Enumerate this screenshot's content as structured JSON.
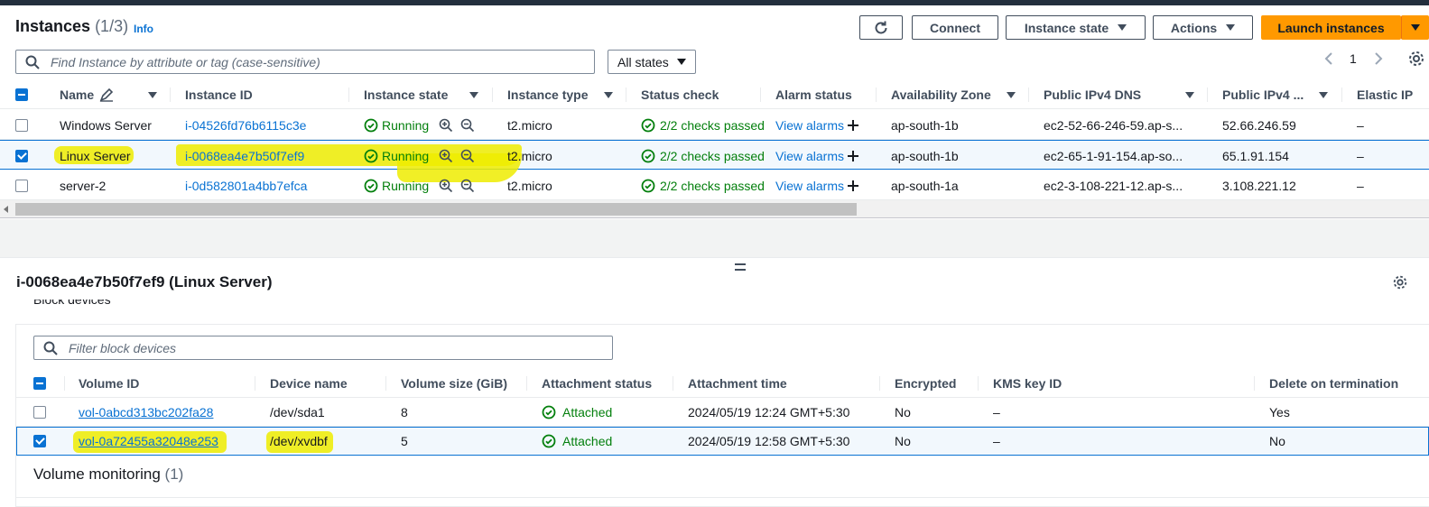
{
  "header": {
    "title": "Instances",
    "count": "(1/3)",
    "info": "Info",
    "buttons": {
      "connect": "Connect",
      "instance_state": "Instance state",
      "actions": "Actions",
      "launch": "Launch instances"
    }
  },
  "search": {
    "placeholder": "Find Instance by attribute or tag (case-sensitive)",
    "state_filter": "All states"
  },
  "pagination": {
    "page": "1"
  },
  "instances_table": {
    "columns": [
      "Name",
      "Instance ID",
      "Instance state",
      "Instance type",
      "Status check",
      "Alarm status",
      "Availability Zone",
      "Public IPv4 DNS",
      "Public IPv4 ...",
      "Elastic IP"
    ],
    "rows": [
      {
        "name": "Windows Server",
        "id": "i-04526fd76b6115c3e",
        "state": "Running",
        "type": "t2.micro",
        "status": "2/2 checks passed",
        "alarm": "View alarms",
        "az": "ap-south-1b",
        "dns": "ec2-52-66-246-59.ap-s...",
        "ipv4": "52.66.246.59",
        "eip": "–",
        "selected": false
      },
      {
        "name": "Linux Server",
        "id": "i-0068ea4e7b50f7ef9",
        "state": "Running",
        "type": "t2.micro",
        "status": "2/2 checks passed",
        "alarm": "View alarms",
        "az": "ap-south-1b",
        "dns": "ec2-65-1-91-154.ap-so...",
        "ipv4": "65.1.91.154",
        "eip": "–",
        "selected": true
      },
      {
        "name": "server-2",
        "id": "i-0d582801a4bb7efca",
        "state": "Running",
        "type": "t2.micro",
        "status": "2/2 checks passed",
        "alarm": "View alarms",
        "az": "ap-south-1a",
        "dns": "ec2-3-108-221-12.ap-s...",
        "ipv4": "3.108.221.12",
        "eip": "–",
        "selected": false
      }
    ]
  },
  "details": {
    "title": "i-0068ea4e7b50f7ef9 (Linux Server)",
    "section": "Block devices",
    "filter_placeholder": "Filter block devices",
    "volumes_table": {
      "columns": [
        "Volume ID",
        "Device name",
        "Volume size (GiB)",
        "Attachment status",
        "Attachment time",
        "Encrypted",
        "KMS key ID",
        "Delete on termination"
      ],
      "rows": [
        {
          "volume_id": "vol-0abcd313bc202fa28",
          "device": "/dev/sda1",
          "size": "8",
          "status": "Attached",
          "time": "2024/05/19 12:24 GMT+5:30",
          "encrypted": "No",
          "kms": "–",
          "delete": "Yes",
          "selected": false
        },
        {
          "volume_id": "vol-0a72455a32048e253",
          "device": "/dev/xvdbf",
          "size": "5",
          "status": "Attached",
          "time": "2024/05/19 12:58 GMT+5:30",
          "encrypted": "No",
          "kms": "–",
          "delete": "No",
          "selected": true
        }
      ]
    },
    "monitoring": {
      "label": "Volume monitoring",
      "count": "(1)"
    }
  },
  "icons": {
    "refresh": "refresh-icon",
    "search": "search-icon",
    "edit": "pencil-icon",
    "running": "check-circle-icon",
    "zoom_in": "zoom-in-icon",
    "zoom_out": "zoom-out-icon",
    "add": "plus-icon",
    "settings": "gear-icon",
    "split": "drag-handle-icon"
  },
  "colors": {
    "primary": "#ff9900",
    "link": "#0972d3",
    "success": "#037f0c",
    "highlight": "#eeec00"
  }
}
